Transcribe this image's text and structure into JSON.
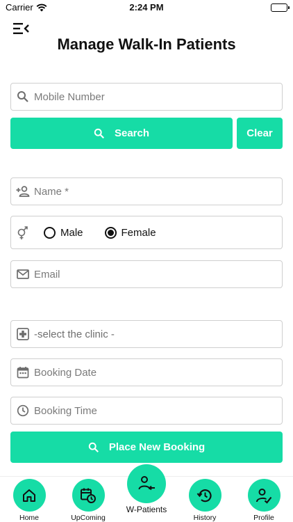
{
  "status_bar": {
    "carrier": "Carrier",
    "time": "2:24 PM"
  },
  "header": {
    "title": "Manage Walk-In Patients"
  },
  "search": {
    "mobile_placeholder": "Mobile Number",
    "search_label": "Search",
    "clear_label": "Clear"
  },
  "form": {
    "name_placeholder": "Name *",
    "gender_options": [
      "Male",
      "Female"
    ],
    "gender_selected": "Female",
    "email_placeholder": "Email",
    "clinic_select": "-select the clinic -",
    "booking_date_placeholder": "Booking Date",
    "booking_time_placeholder": "Booking Time",
    "place_booking_label": "Place New Booking"
  },
  "tabbar": {
    "items": [
      {
        "label": "Home",
        "icon": "home-icon"
      },
      {
        "label": "UpComing",
        "icon": "calendar-clock-icon"
      },
      {
        "label": "W-Patients",
        "icon": "person-arrow-icon"
      },
      {
        "label": "History",
        "icon": "history-icon"
      },
      {
        "label": "Profile",
        "icon": "person-check-icon"
      }
    ]
  },
  "colors": {
    "accent": "#16dca6",
    "border": "#cfcfcf"
  }
}
